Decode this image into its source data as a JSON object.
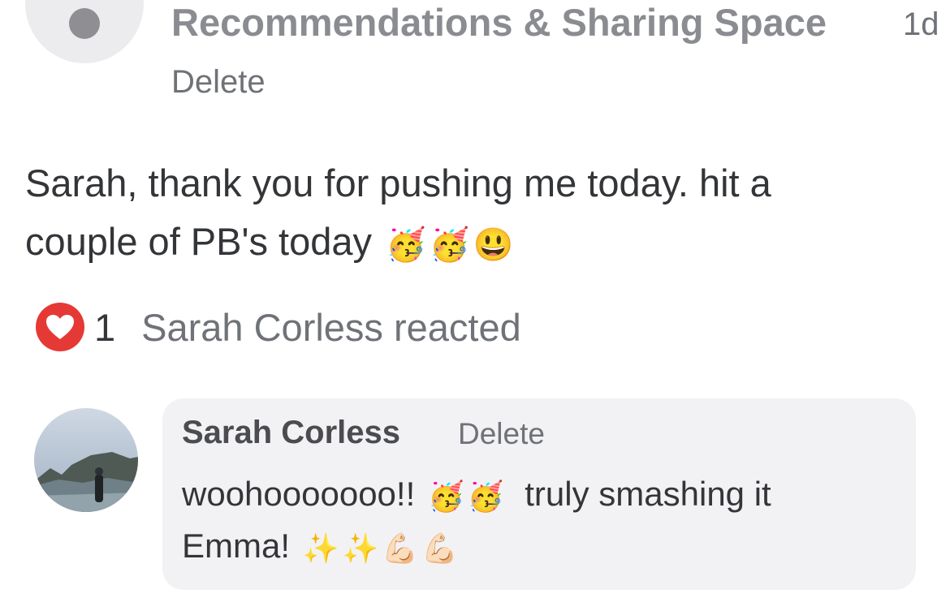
{
  "post": {
    "space_title": "Recommendations & Sharing Space",
    "time": "1d",
    "delete_label": "Delete",
    "text_line1": "Sarah, thank you for pushing me today. hit a",
    "text_line2": "couple of PB's today",
    "emojis": [
      "🥳",
      "🥳",
      "😃"
    ]
  },
  "reactions": {
    "icon": "heart-icon",
    "color": "#e53935",
    "count": "1",
    "text": "Sarah Corless reacted"
  },
  "comment": {
    "author": "Sarah Corless",
    "delete_label": "Delete",
    "text_line1_part1": "woohooooooo!!",
    "emojis_line1": [
      "🥳",
      "🥳"
    ],
    "text_line1_part2": "truly smashing it",
    "text_line2": "Emma!",
    "emojis_line2": [
      "✨",
      "✨",
      "💪🏻",
      "💪🏻"
    ]
  }
}
